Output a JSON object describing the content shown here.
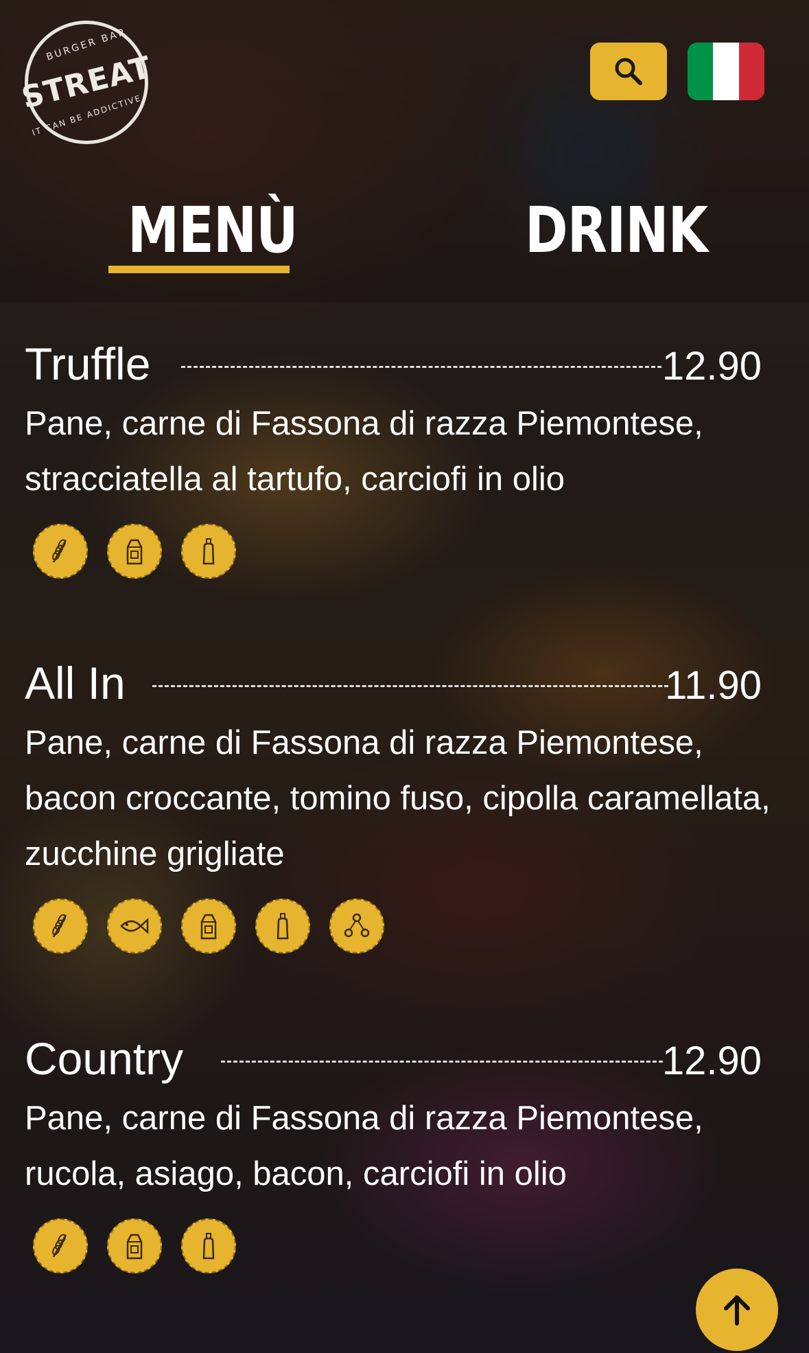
{
  "brand": {
    "logo_top": "BURGER BAR",
    "logo_main": "STREAT",
    "logo_bottom": "IT CAN BE ADDICTIVE"
  },
  "header": {
    "search_icon": "search-icon",
    "language_flag": "italy-flag",
    "flag_colors": [
      "#009246",
      "#ffffff",
      "#ce2b37"
    ]
  },
  "tabs": [
    {
      "label": "MENÙ",
      "active": true
    },
    {
      "label": "DRINK",
      "active": false
    }
  ],
  "items": [
    {
      "name": "Truffle",
      "price": "12.90",
      "description": "Pane, carne di Fassona di razza Piemontese, stracciatella al tartufo, carciofi in olio",
      "allergens": [
        "wheat-icon",
        "milk-icon",
        "sauce-bottle-icon"
      ]
    },
    {
      "name": "All In",
      "price": "11.90",
      "description": "Pane, carne di Fassona di razza Piemontese, bacon croccante, tomino fuso, cipolla caramellata, zucchine grigliate",
      "allergens": [
        "wheat-icon",
        "fish-icon",
        "milk-icon",
        "sauce-bottle-icon",
        "molecule-icon"
      ]
    },
    {
      "name": "Country",
      "price": "12.90",
      "description": "Pane, carne di Fassona di razza Piemontese, rucola, asiago, bacon, carciofi in olio",
      "allergens": [
        "wheat-icon",
        "milk-icon",
        "sauce-bottle-icon"
      ]
    }
  ],
  "scroll_top_icon": "arrow-up-icon",
  "colors": {
    "accent": "#e6b42e"
  }
}
